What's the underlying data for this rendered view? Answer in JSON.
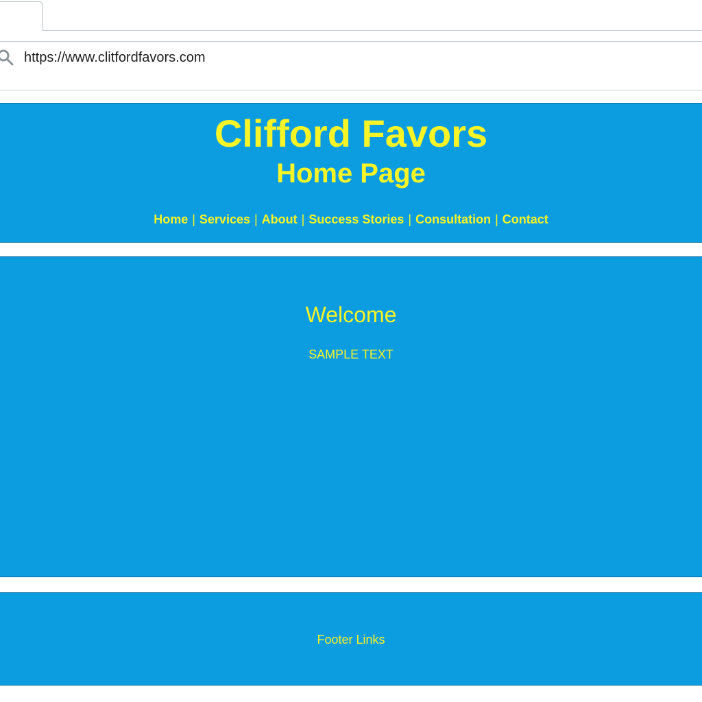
{
  "browser": {
    "url": "https://www.clitfordfavors.com",
    "address_icon": "search-icon"
  },
  "header": {
    "title": "Clifford Favors",
    "subtitle": "Home Page",
    "nav": [
      {
        "label": "Home"
      },
      {
        "label": "Services"
      },
      {
        "label": "About"
      },
      {
        "label": "Success Stories"
      },
      {
        "label": "Consultation"
      },
      {
        "label": "Contact"
      }
    ],
    "separator": "|"
  },
  "main": {
    "heading": "Welcome",
    "body_text": "SAMPLE TEXT"
  },
  "footer": {
    "links_label": "Footer Links"
  },
  "colors": {
    "section_background": "#0b9de0",
    "text_accent": "#f7f427",
    "chrome_background": "#ffffff"
  }
}
